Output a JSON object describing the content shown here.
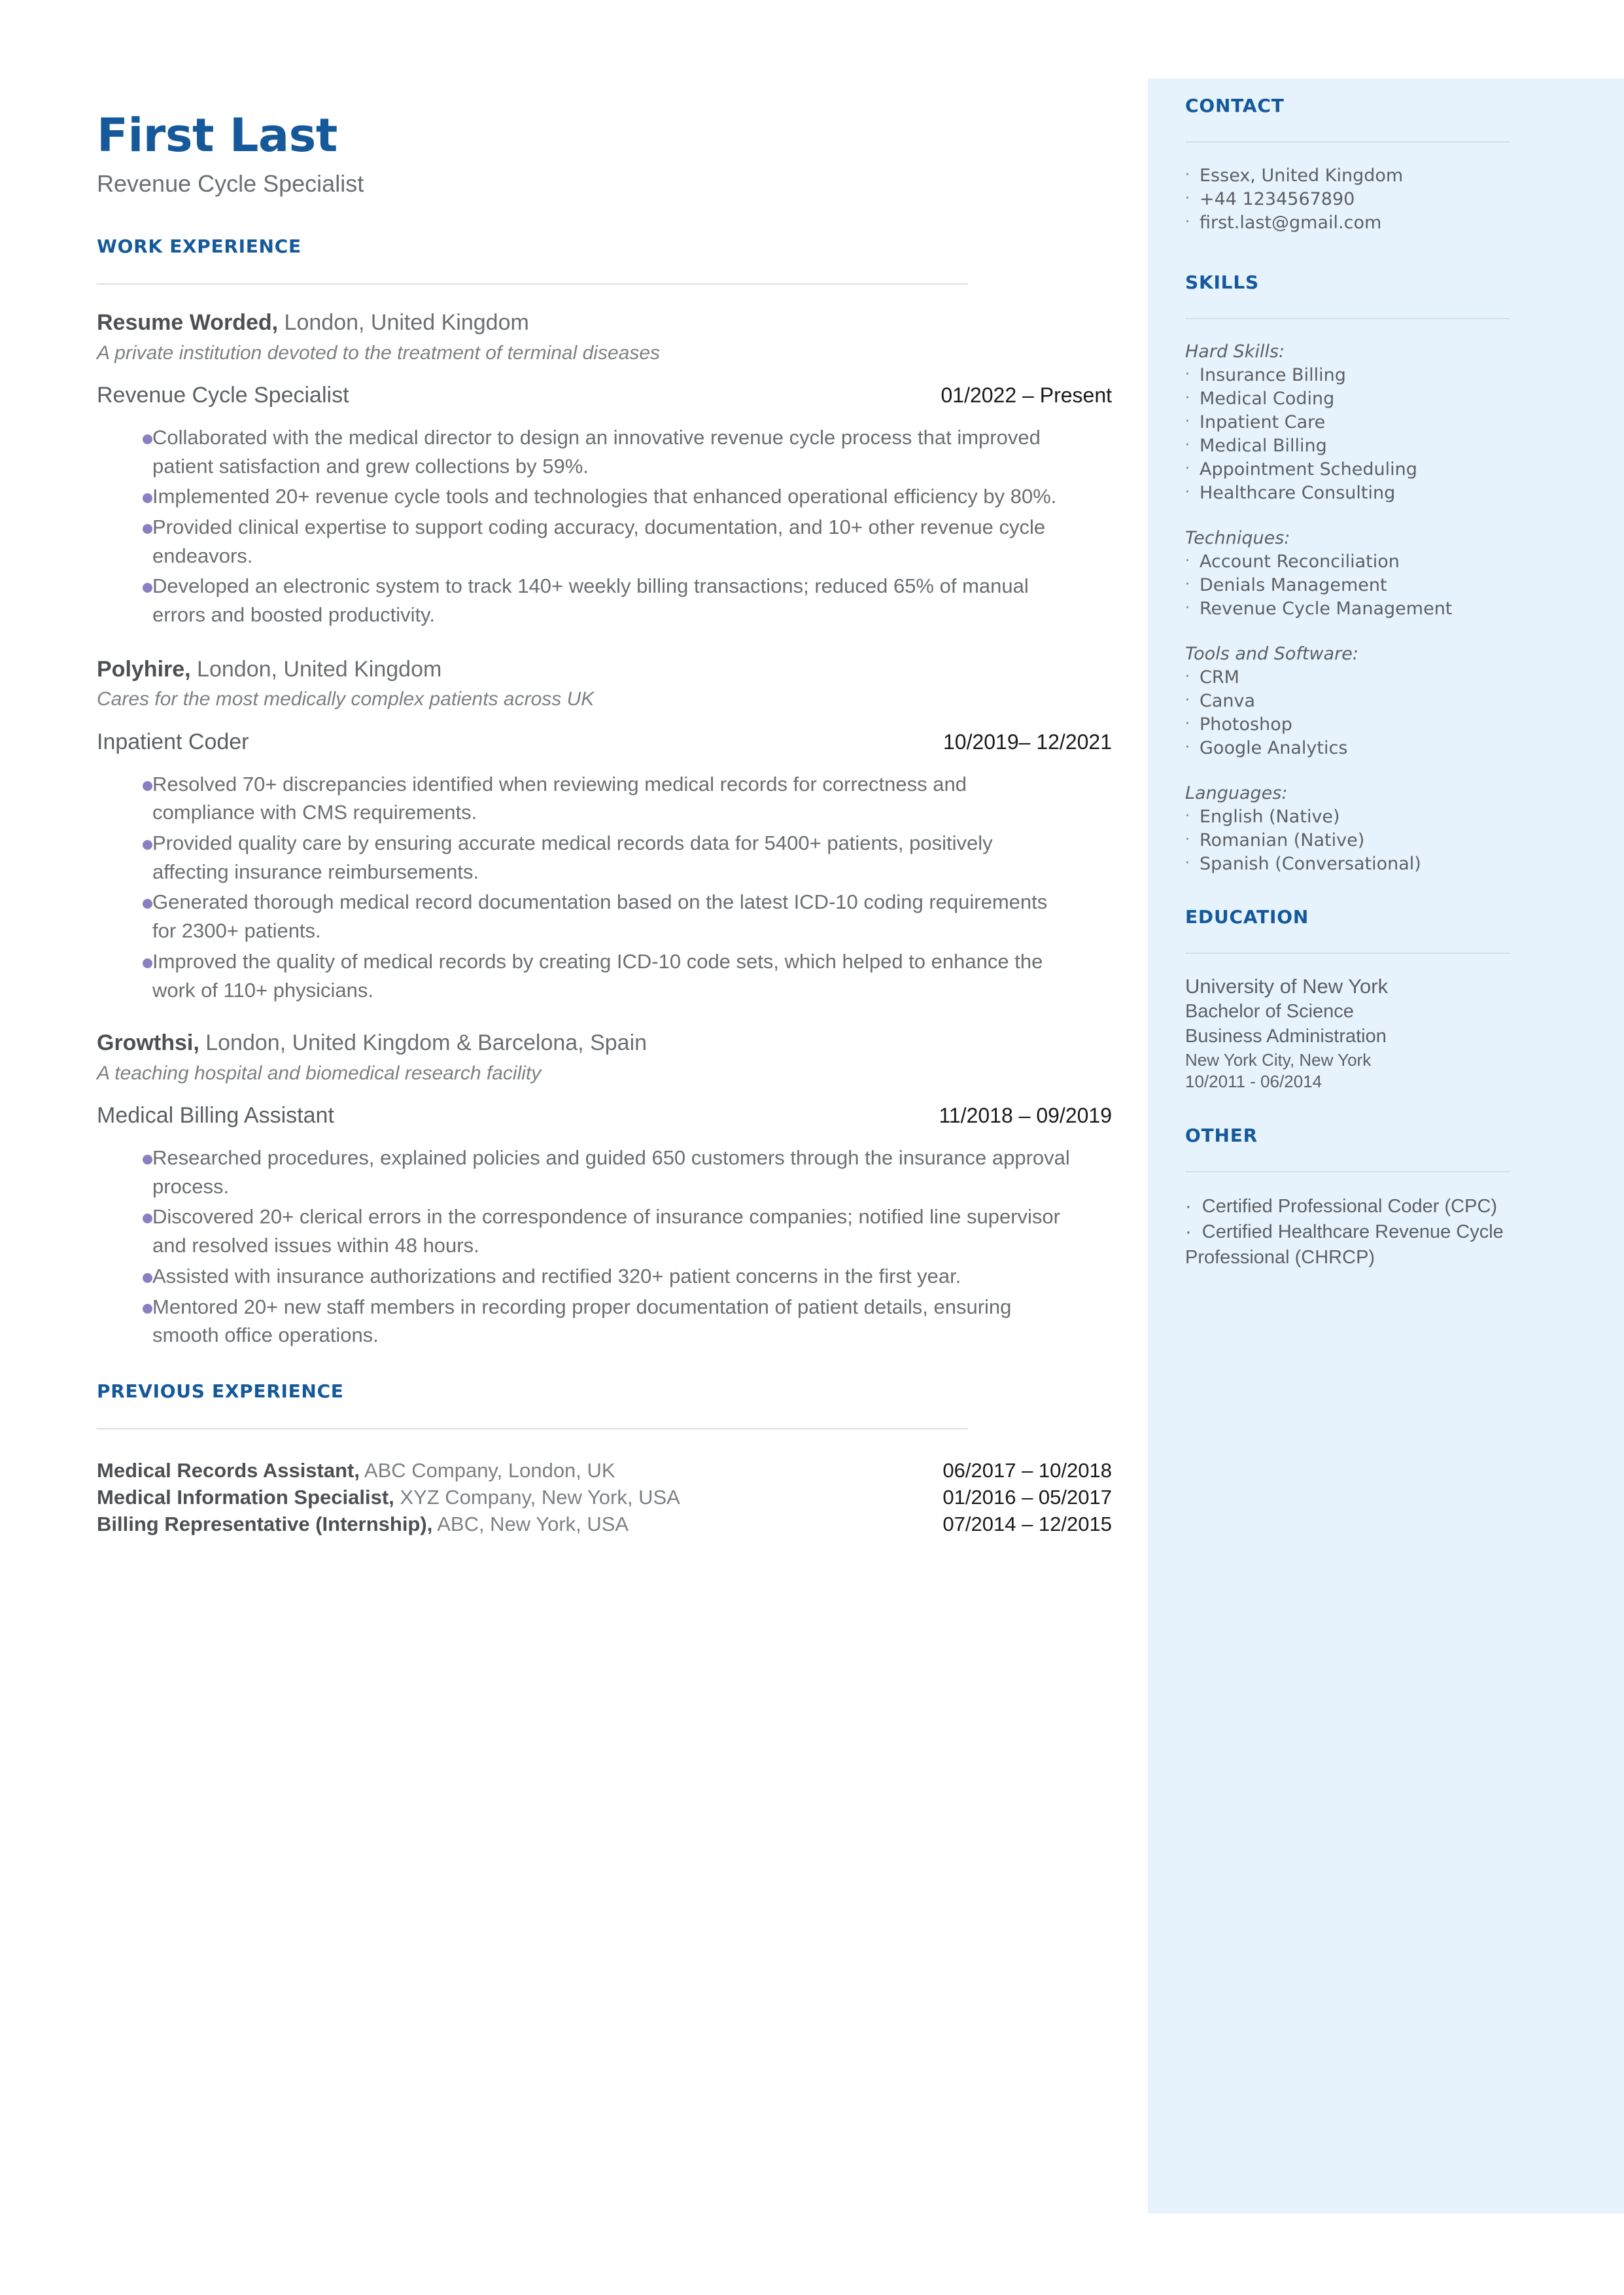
{
  "colors": {
    "accent_blue": "#15599b",
    "sidebar_bg": "#e6f3fd",
    "bullet_purple": "#8b7fc4",
    "body_gray": "#6b6f72",
    "rule_gray": "#dadfe3"
  },
  "header": {
    "name": "First Last",
    "title": "Revenue Cycle Specialist"
  },
  "work_experience": {
    "heading": "WORK EXPERIENCE",
    "jobs": [
      {
        "company": "Resume Worded,",
        "location": " London, United Kingdom",
        "description": "A private institution devoted to the treatment of terminal diseases",
        "role": "Revenue Cycle Specialist",
        "date": "01/2022 – Present",
        "bullets": [
          "Collaborated with the medical director to design an innovative revenue cycle process that improved patient satisfaction and grew collections by 59%.",
          "Implemented 20+ revenue cycle tools and technologies that enhanced operational efficiency by 80%.",
          "Provided clinical expertise to support coding accuracy, documentation, and 10+ other revenue cycle endeavors.",
          "Developed an electronic system to track 140+ weekly billing transactions; reduced 65% of manual errors and boosted productivity."
        ]
      },
      {
        "company": "Polyhire,",
        "location": " London, United Kingdom",
        "description": "Cares for the most medically complex patients across UK",
        "role": "Inpatient Coder",
        "date": "10/2019– 12/2021",
        "bullets": [
          "Resolved 70+ discrepancies identified when reviewing medical records for correctness and compliance with CMS requirements.",
          "Provided quality care by ensuring accurate medical records data for 5400+ patients, positively affecting insurance reimbursements.",
          "Generated thorough medical record documentation based on the latest ICD-10 coding requirements for 2300+ patients.",
          "Improved the quality of medical records by creating ICD-10 code sets, which helped to enhance the work of 110+ physicians."
        ]
      },
      {
        "company": "Growthsi,",
        "location": " London, United Kingdom & Barcelona, Spain",
        "description": "A teaching hospital and biomedical research facility",
        "role": "Medical Billing Assistant",
        "date": "11/2018 – 09/2019",
        "bullets": [
          "Researched procedures, explained policies and guided 650 customers through the insurance approval process.",
          "Discovered 20+ clerical errors in the correspondence of insurance companies; notified line supervisor and resolved issues within 48 hours.",
          "Assisted with insurance authorizations and rectified 320+ patient concerns in the first year.",
          "Mentored 20+ new staff members in recording proper documentation of patient details, ensuring smooth office operations."
        ]
      }
    ]
  },
  "previous_experience": {
    "heading": "PREVIOUS EXPERIENCE",
    "entries": [
      {
        "title": "Medical Records Assistant,",
        "detail": " ABC Company, London, UK",
        "date": "06/2017 – 10/2018"
      },
      {
        "title": "Medical Information Specialist,",
        "detail": " XYZ Company, New York, USA",
        "date": "01/2016 – 05/2017"
      },
      {
        "title": "Billing Representative (Internship),",
        "detail": " ABC, New York, USA",
        "date": "07/2014 – 12/2015"
      }
    ]
  },
  "sidebar": {
    "contact": {
      "heading": "CONTACT",
      "items": [
        " Essex, United Kingdom",
        "+44 1234567890",
        "first.last@gmail.com"
      ]
    },
    "skills": {
      "heading": "SKILLS",
      "groups": [
        {
          "label": "Hard Skills:",
          "items": [
            "Insurance Billing",
            "Medical Coding",
            "Inpatient Care",
            "Medical Billing",
            "Appointment Scheduling",
            "Healthcare Consulting"
          ]
        },
        {
          "label": "Techniques:",
          "items": [
            "Account Reconciliation",
            "Denials Management",
            "Revenue Cycle Management"
          ]
        },
        {
          "label": "Tools and Software:",
          "items": [
            "CRM",
            "Canva",
            "Photoshop",
            "Google Analytics"
          ]
        },
        {
          "label": "Languages:",
          "items": [
            "English (Native)",
            "Romanian (Native)",
            "Spanish (Conversational)"
          ]
        }
      ]
    },
    "education": {
      "heading": "EDUCATION",
      "school": "University of New York",
      "degree": "Bachelor of Science",
      "field": "Business Administration",
      "location": "New York City, New York",
      "dates": "10/2011 - 06/2014"
    },
    "other": {
      "heading": "OTHER",
      "items": [
        "Certified Professional Coder (CPC)",
        "Certified Healthcare Revenue Cycle Professional (CHRCP)"
      ]
    }
  }
}
